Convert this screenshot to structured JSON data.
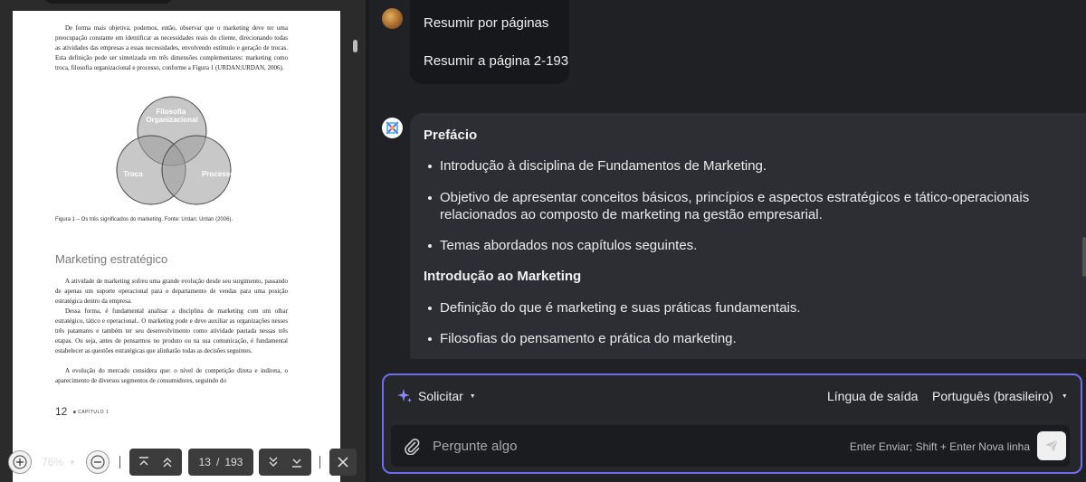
{
  "pdf": {
    "paragraph1": "De forma mais objetiva, podemos, então, observar que o marketing deve ter uma preocupação constante em identificar as necessidades reais do cliente, direcionando todas as atividades das empresas a essas necessidades, envolvendo estímulo e geração de trocas. Esta definição pode ser sintetizada em três dimensões complementares: marketing como troca, filosofia organizacional e processo, conforme a Figura 1 (URDAN;URDAN, 2006).",
    "venn": {
      "top": "Filosofia Organizacional",
      "left": "Troca",
      "right": "Processo"
    },
    "caption": "Figura 1 – Os três significados do marketing. Fonte: Urdan; Urdan (2006).",
    "section_title": "Marketing estratégico",
    "paragraph2": "A atividade de marketing sofreu uma grande evolução desde seu surgimento, passando de apenas um suporte operacional para o departamento de vendas para uma posição estratégica dentro da empresa.",
    "paragraph3": "Dessa forma, é fundamental analisar a disciplina de marketing com um olhar estratégico, tático e operacional.. O marketing pode e deve auxiliar as organizações nesses três patamares e também ter seu desenvolvimento como atividade pautada nessas três etapas. Ou seja, antes de pensarmos no produto ou na sua comunicação, é fundamental estabelecer as questões estratégicas que alinharão todas as decisões seguintes.",
    "paragraph4": "A evolução do mercado considera que: o nível de competição direta e indireta, o aparecimento de diversos segmentos de consumidores, seguindo do",
    "page_number": "12",
    "chapter": "CAPÍTULO 1"
  },
  "toolbar": {
    "zoom": "76%",
    "current_page": "13",
    "separator": "/",
    "total_pages": "193"
  },
  "chat": {
    "user_messages": [
      "Resumir por páginas",
      "Resumir a página 2-193"
    ],
    "response": {
      "heading1": "Prefácio",
      "items1": [
        "Introdução à disciplina de Fundamentos de Marketing.",
        "Objetivo de apresentar conceitos básicos, princípios e aspectos estratégicos e tático-operacionais relacionados ao composto de marketing na gestão empresarial.",
        "Temas abordados nos capítulos seguintes."
      ],
      "heading2": "Introdução ao Marketing",
      "items2": [
        "Definição do que é marketing e suas práticas fundamentais.",
        "Filosofias do pensamento e prática do marketing."
      ]
    }
  },
  "input": {
    "prompt_label": "Solicitar",
    "output_language_label": "Língua de saída",
    "language_value": "Português (brasileiro)",
    "placeholder": "Pergunte algo",
    "hint": "Enter Enviar; Shift + Enter Nova linha"
  },
  "colors": {
    "accent_border": "#6f6cf0",
    "background": "#202124",
    "ai_bubble": "#2d2e33"
  }
}
